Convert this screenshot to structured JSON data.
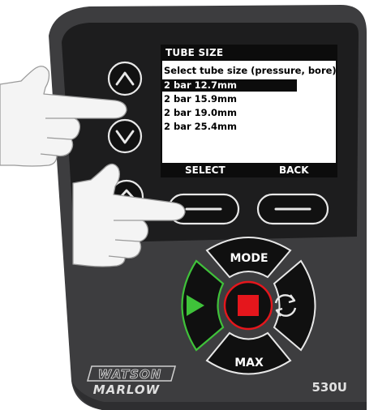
{
  "screen": {
    "title": "TUBE SIZE",
    "prompt": "Select tube size (pressure, bore)",
    "options": [
      "2 bar 12.7mm",
      "2 bar 15.9mm",
      "2 bar 19.0mm",
      "2 bar 25.4mm"
    ],
    "selected_index": 0,
    "softkey_left": "SELECT",
    "softkey_right": "BACK"
  },
  "keypad": {
    "mode_label": "MODE",
    "max_label": "MAX"
  },
  "brand": {
    "line1": "WATSON",
    "line2": "MARLOW",
    "model": "530U"
  },
  "colors": {
    "housing": "#3d3d3f",
    "panel": "#1c1c1c",
    "run_green": "#3fc23a",
    "stop_red": "#e5161c",
    "hand": "#f4f4f4"
  }
}
